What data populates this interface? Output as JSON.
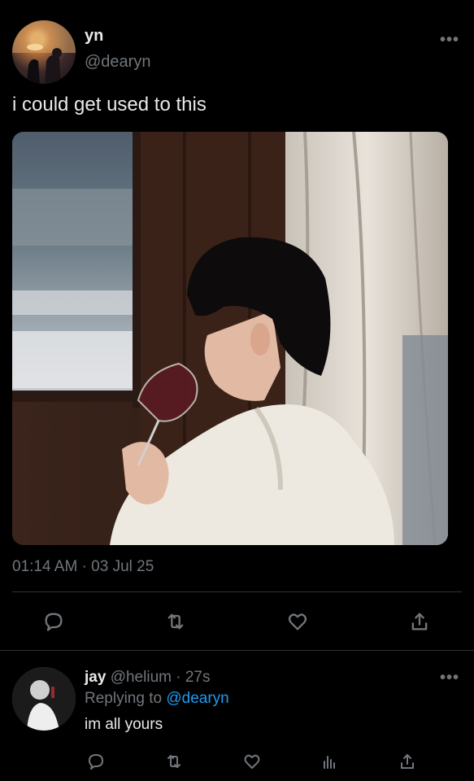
{
  "tweet": {
    "name": "yn",
    "handle": "@dearyn",
    "text": "i could get used to this",
    "timestamp": "01:14 AM · 03 Jul 25",
    "more_label": "•••"
  },
  "reply": {
    "name": "jay",
    "handle": "@helium",
    "time": "· 27s",
    "replying_prefix": "Replying to",
    "replying_to": "@dearyn",
    "text": "im all yours",
    "more_label": "•••"
  },
  "icons": {
    "actions": [
      "reply-icon",
      "retweet-icon",
      "like-icon",
      "share-icon"
    ],
    "reply_actions": [
      "reply-icon",
      "retweet-icon",
      "like-icon",
      "views-icon",
      "share-icon"
    ]
  },
  "colors": {
    "background": "#000000",
    "text": "#e7e9ea",
    "muted": "#71767b",
    "mention": "#1d9bf0",
    "divider": "#2f3336"
  }
}
